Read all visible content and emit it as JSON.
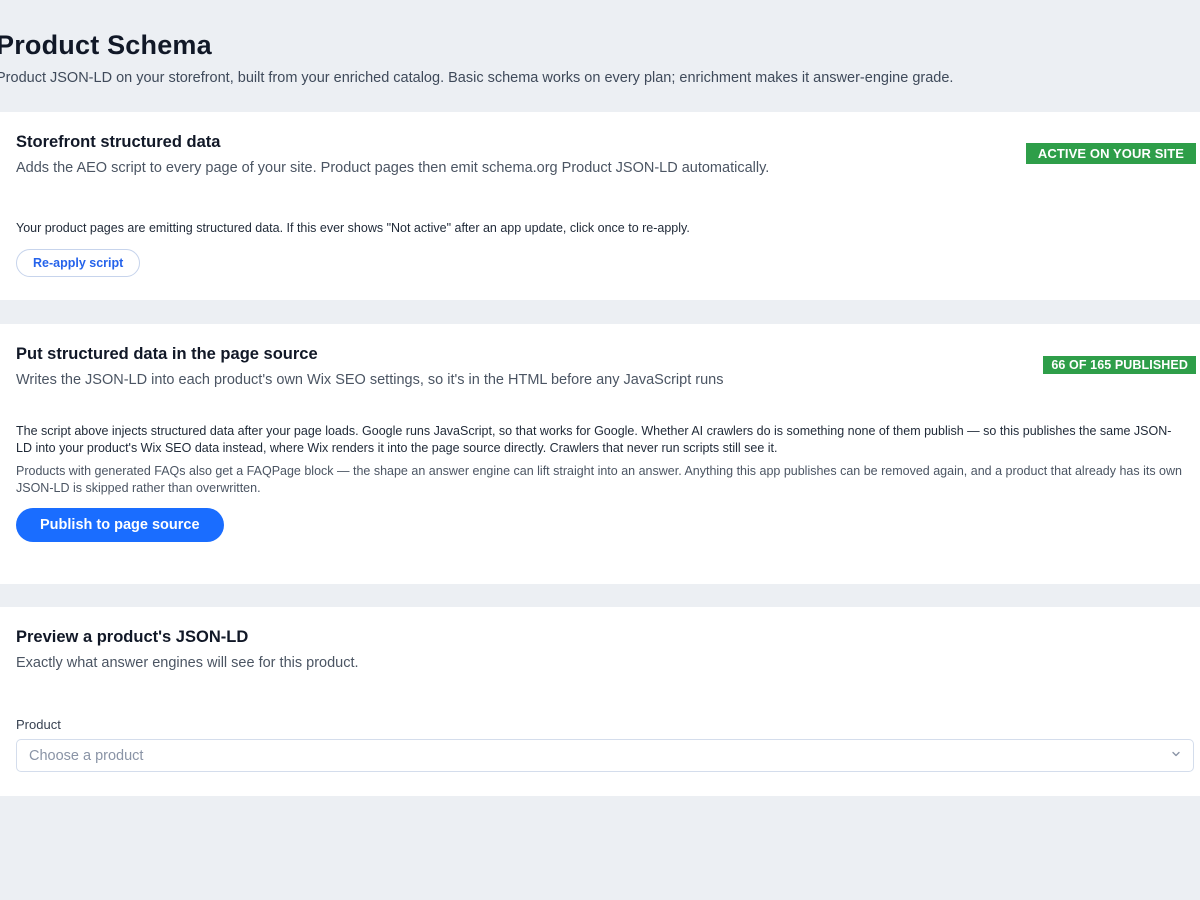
{
  "header": {
    "title": "Product Schema",
    "subtitle": "Product JSON-LD on your storefront, built from your enriched catalog. Basic schema works on every plan; enrichment makes it answer-engine grade."
  },
  "storefront": {
    "title": "Storefront structured data",
    "description": "Adds the AEO script to every page of your site. Product pages then emit schema.org Product JSON-LD automatically.",
    "badge": "ACTIVE ON YOUR SITE",
    "status_text": "Your product pages are emitting structured data. If this ever shows \"Not active\" after an app update, click once to re-apply.",
    "button_label": "Re-apply script"
  },
  "page_source": {
    "title": "Put structured data in the page source",
    "description": "Writes the JSON-LD into each product's own Wix SEO settings, so it's in the HTML before any JavaScript runs",
    "badge": "66 OF 165 PUBLISHED",
    "paragraph_1": "The script above injects structured data after your page loads. Google runs JavaScript, so that works for Google. Whether AI crawlers do is something none of them publish — so this publishes the same JSON-LD into your product's Wix SEO data instead, where Wix renders it into the page source directly. Crawlers that never run scripts still see it.",
    "paragraph_2": "Products with generated FAQs also get a FAQPage block — the shape an answer engine can lift straight into an answer. Anything this app publishes can be removed again, and a product that already has its own JSON-LD is skipped rather than overwritten.",
    "button_label": "Publish to page source",
    "published_count": 66,
    "total_count": 165
  },
  "preview": {
    "title": "Preview a product's JSON-LD",
    "description": "Exactly what answer engines will see for this product.",
    "field_label": "Product",
    "select_placeholder": "Choose a product",
    "select_icon": "chevron-down-icon"
  },
  "colors": {
    "background": "#eceff3",
    "card": "#ffffff",
    "badge_green": "#2e9e49",
    "primary_blue": "#1a6dff",
    "link_blue": "#2563eb"
  }
}
